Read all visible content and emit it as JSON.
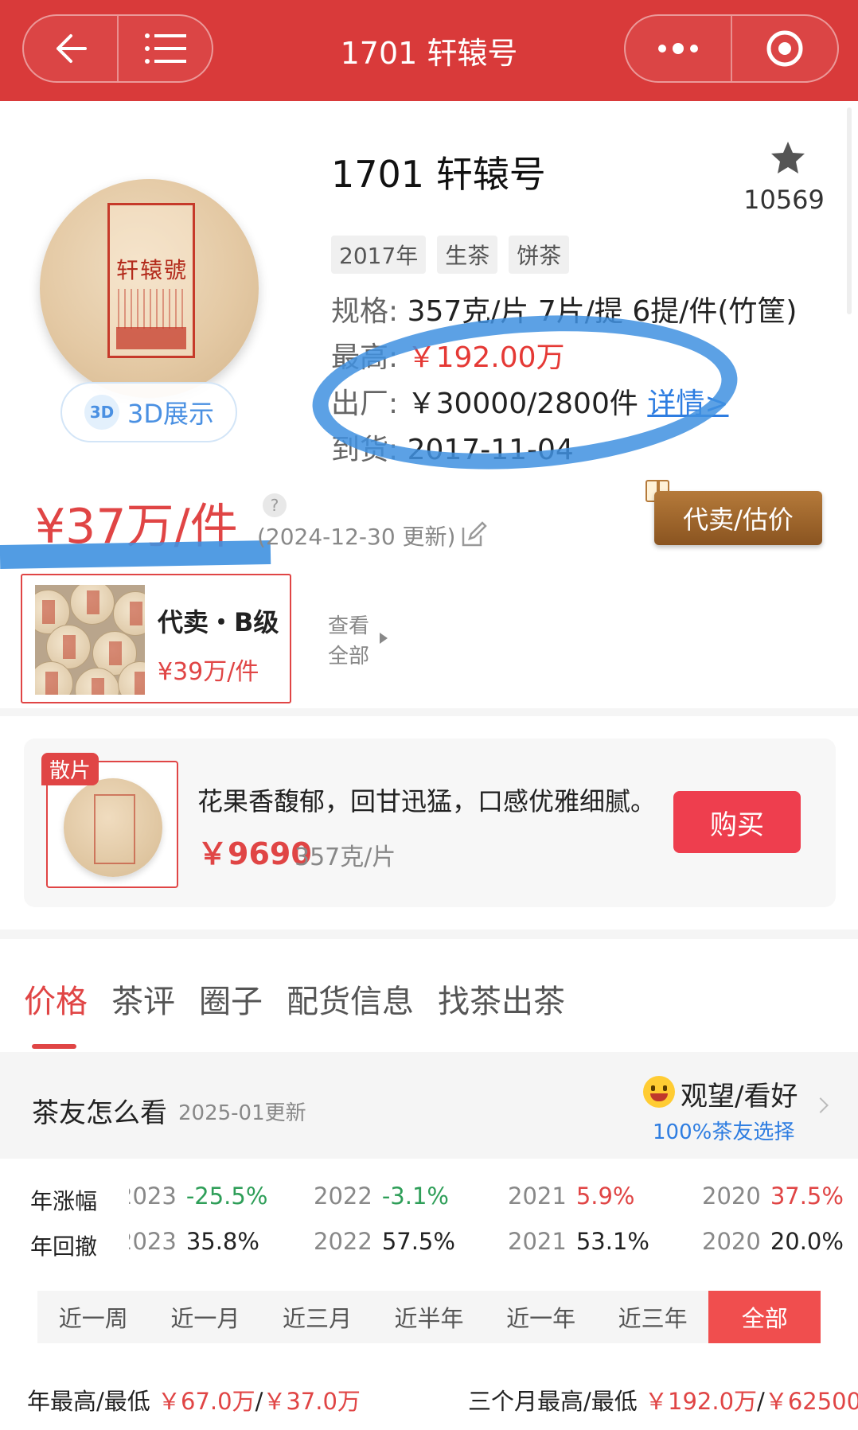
{
  "header": {
    "title": "1701 轩辕号",
    "back_icon": "back-arrow-icon",
    "menu_icon": "list-menu-icon",
    "more_icon": "more-dots-icon",
    "target_icon": "close-target-icon",
    "brand_color": "#d93a3a"
  },
  "product": {
    "name": "1701 轩辕号",
    "favorite_count": "10569",
    "tags": [
      "2017年",
      "生茶",
      "饼茶"
    ],
    "spec_label": "规格:",
    "spec_value": "357克/片 7片/提 6提/件(竹筐)",
    "high_label": "最高:",
    "high_value": "￥192.00万",
    "factory_label": "出厂:",
    "factory_value": "￥30000/2800件",
    "factory_link": "详情>",
    "arrival_label": "到货:",
    "arrival_value": "2017-11-04",
    "btn_3d_icon_text": "3D",
    "btn_3d_label": "3D展示",
    "cake_text": "轩辕號"
  },
  "price": {
    "main": "¥37万/件",
    "help_text": "?",
    "updated": "(2024-12-30 更新)",
    "sell_button": "代卖/估价"
  },
  "listing": {
    "title": "代卖・B级",
    "price": "¥39万/件",
    "view_all_line1": "查看",
    "view_all_line2": "全部"
  },
  "loose": {
    "badge": "散片",
    "description": "花果香馥郁，回甘迅猛，口感优雅细腻。",
    "price": "￥9690",
    "unit": "357克/片",
    "buy_button": "购买"
  },
  "tabs": [
    {
      "label": "价格",
      "active": true
    },
    {
      "label": "茶评",
      "active": false
    },
    {
      "label": "圈子",
      "active": false
    },
    {
      "label": "配货信息",
      "active": false
    },
    {
      "label": "找茶出茶",
      "active": false
    }
  ],
  "opinion": {
    "title": "茶友怎么看",
    "date": "2025-01更新",
    "choice": "观望/看好",
    "percent": "100%茶友选择"
  },
  "stats": {
    "rise_label": "年涨幅",
    "rise": [
      {
        "year": "2023",
        "value": "-25.5%",
        "tone": "neg"
      },
      {
        "year": "2022",
        "value": "-3.1%",
        "tone": "neg"
      },
      {
        "year": "2021",
        "value": "5.9%",
        "tone": "pos"
      },
      {
        "year": "2020",
        "value": "37.5%",
        "tone": "pos"
      }
    ],
    "drawdown_label": "年回撤",
    "drawdown": [
      {
        "year": "2023",
        "value": "35.8%",
        "tone": "neutral"
      },
      {
        "year": "2022",
        "value": "57.5%",
        "tone": "neutral"
      },
      {
        "year": "2021",
        "value": "53.1%",
        "tone": "neutral"
      },
      {
        "year": "2020",
        "value": "20.0%",
        "tone": "neutral"
      }
    ]
  },
  "ranges": [
    {
      "label": "近一周",
      "active": false
    },
    {
      "label": "近一月",
      "active": false
    },
    {
      "label": "近三月",
      "active": false
    },
    {
      "label": "近半年",
      "active": false
    },
    {
      "label": "近一年",
      "active": false
    },
    {
      "label": "近三年",
      "active": false
    },
    {
      "label": "全部",
      "active": true
    }
  ],
  "summary": {
    "year_label": "年最高/最低",
    "year_high": "￥67.0万",
    "sep": "/",
    "year_low": "￥37.0万",
    "quarter_label": "三个月最高/最低",
    "quarter_high": "￥192.0万",
    "quarter_low": "￥62500"
  }
}
